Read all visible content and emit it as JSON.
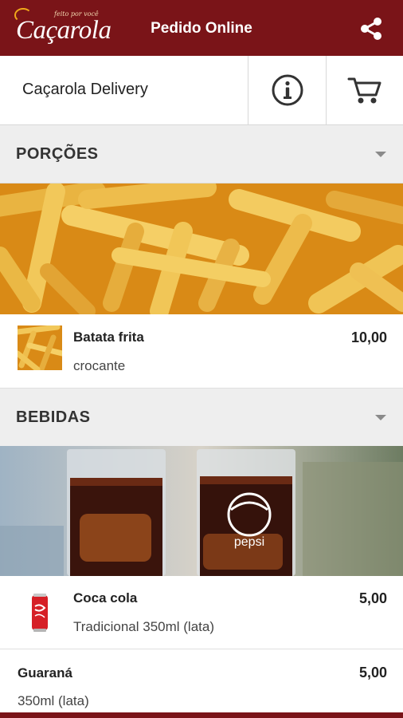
{
  "topbar": {
    "logo_small_text": "feito por você",
    "logo_text": "Caçarola",
    "title": "Pedido Online",
    "share_icon": "share-icon",
    "color": "#7a1418"
  },
  "header": {
    "store_name": "Caçarola Delivery",
    "info_icon": "info-icon",
    "cart_icon": "cart-icon"
  },
  "sections": [
    {
      "title": "PORÇÕES",
      "items": [
        {
          "name": "Batata frita",
          "description": "crocante",
          "price": "10,00"
        }
      ]
    },
    {
      "title": "BEBIDAS",
      "items": [
        {
          "name": "Coca cola",
          "description": "Tradicional 350ml (lata)",
          "price": "5,00"
        },
        {
          "name": "Guaraná",
          "description": "350ml (lata)",
          "price": "5,00"
        }
      ]
    }
  ],
  "banners": {
    "pepsi_text": "pepsi"
  }
}
